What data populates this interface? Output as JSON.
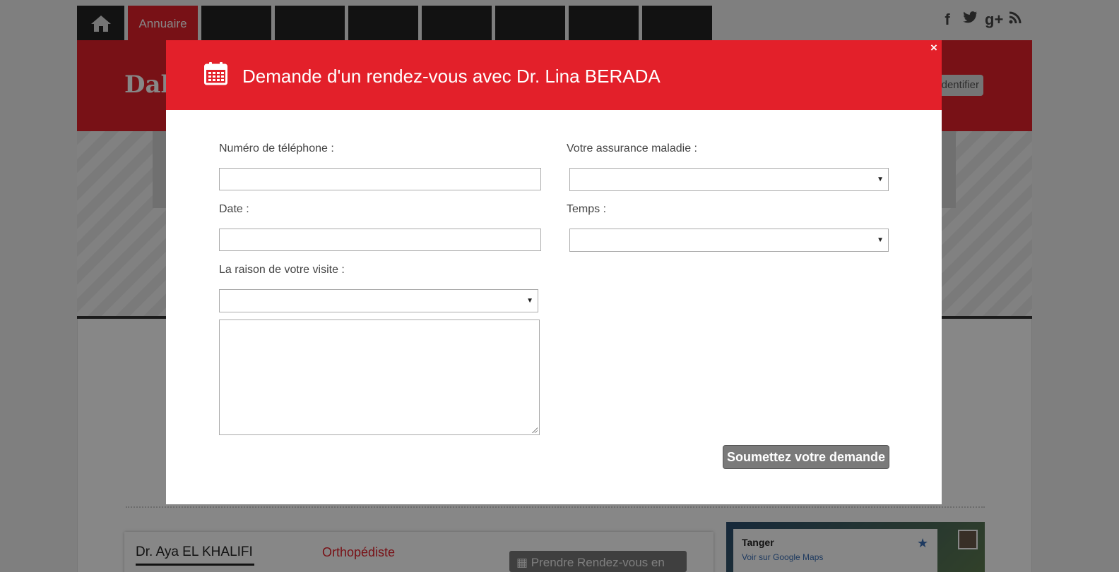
{
  "nav": {
    "active_tab": "Annuaire"
  },
  "header": {
    "brand_fragment": "Dali",
    "login_fragment": "dentifier"
  },
  "social": {
    "facebook": "f",
    "googleplus": "g+"
  },
  "card": {
    "doctor_name": "Dr. Aya EL KHALIFI",
    "specialty": "Orthopédiste",
    "button_label": "Prendre Rendez-vous en"
  },
  "map": {
    "place": "Tanger",
    "link": "Voir sur Google Maps"
  },
  "modal": {
    "title": "Demande d'un rendez-vous avec Dr. Lina BERADA",
    "close_symbol": "×",
    "phone_label": "Numéro de téléphone :",
    "phone_value": "",
    "insurance_label": "Votre assurance maladie :",
    "insurance_value": "",
    "date_label": "Date :",
    "date_value": "",
    "time_label": "Temps :",
    "time_value": "",
    "reason_label": "La raison de votre visite :",
    "reason_value": "",
    "message_value": "",
    "submit_label": "Soumettez votre demande"
  },
  "colors": {
    "brand_red": "#e3202a",
    "submit_gray": "#7a7a7a"
  }
}
